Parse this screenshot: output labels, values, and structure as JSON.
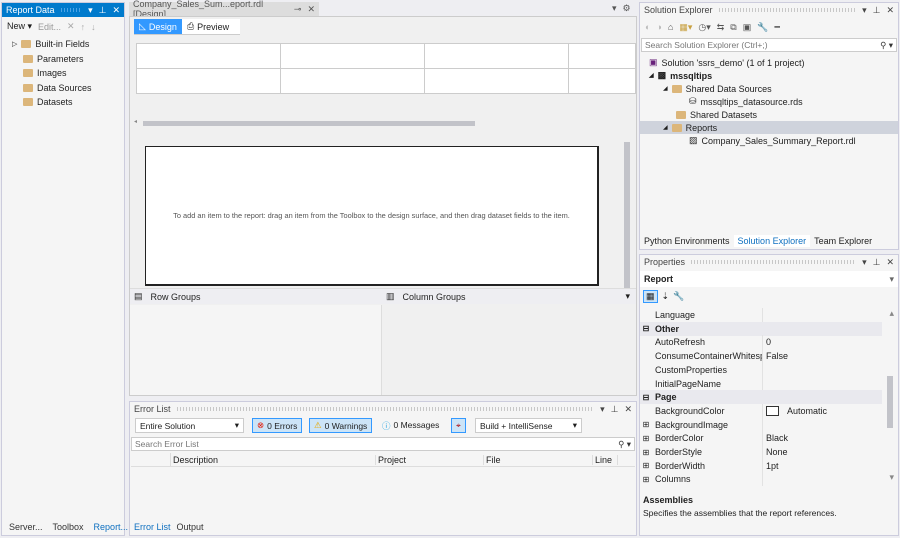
{
  "report_data": {
    "title": "Report Data",
    "toolbar": {
      "new": "New ▾",
      "edit": "Edit..."
    },
    "items": [
      "Built-in Fields",
      "Parameters",
      "Images",
      "Data Sources",
      "Datasets"
    ],
    "bottom_tabs": [
      "Server...",
      "Toolbox",
      "Report..."
    ]
  },
  "document": {
    "tab_title": "Company_Sales_Sum...eport.rdl [Design]",
    "tabs": [
      "Design",
      "Preview"
    ],
    "hint": "To add an item to the report: drag an item from the Toolbox to the design surface, and then drag dataset fields to the item.",
    "row_groups": "Row Groups",
    "column_groups": "Column Groups"
  },
  "error_list": {
    "title": "Error List",
    "scope": "Entire Solution",
    "errors": "0 Errors",
    "warnings": "0 Warnings",
    "messages": "0 Messages",
    "build": "Build + IntelliSense",
    "search_placeholder": "Search Error List",
    "columns": [
      "Description",
      "Project",
      "File",
      "Line"
    ],
    "bottom_tabs": [
      "Error List",
      "Output"
    ]
  },
  "solution_explorer": {
    "title": "Solution Explorer",
    "search_placeholder": "Search Solution Explorer (Ctrl+;)",
    "tree": [
      "Solution 'ssrs_demo' (1 of 1 project)",
      "mssqltips",
      "Shared Data Sources",
      "mssqltips_datasource.rds",
      "Shared Datasets",
      "Reports",
      "Company_Sales_Summary_Report.rdl"
    ],
    "tabs": [
      "Python Environments",
      "Solution Explorer",
      "Team Explorer"
    ]
  },
  "properties": {
    "title": "Properties",
    "object": "Report",
    "rows": [
      {
        "name": "Language",
        "value": "",
        "type": "prop"
      },
      {
        "name": "Other",
        "value": "",
        "type": "cat"
      },
      {
        "name": "AutoRefresh",
        "value": "0",
        "type": "prop"
      },
      {
        "name": "ConsumeContainerWhitespa",
        "value": "False",
        "type": "prop"
      },
      {
        "name": "CustomProperties",
        "value": "",
        "type": "prop"
      },
      {
        "name": "InitialPageName",
        "value": "",
        "type": "prop"
      },
      {
        "name": "Page",
        "value": "",
        "type": "cat"
      },
      {
        "name": "BackgroundColor",
        "value": "Automatic",
        "type": "prop",
        "swatch": "#ffffff"
      },
      {
        "name": "BackgroundImage",
        "value": "",
        "type": "expand"
      },
      {
        "name": "BorderColor",
        "value": "Black",
        "type": "expand"
      },
      {
        "name": "BorderStyle",
        "value": "None",
        "type": "expand"
      },
      {
        "name": "BorderWidth",
        "value": "1pt",
        "type": "expand"
      },
      {
        "name": "Columns",
        "value": "",
        "type": "expand"
      }
    ],
    "desc_title": "Assemblies",
    "desc_text": "Specifies the assemblies that the report references."
  },
  "colors": {
    "accent": "#007acc",
    "selected_row": "#cfd3dc"
  }
}
